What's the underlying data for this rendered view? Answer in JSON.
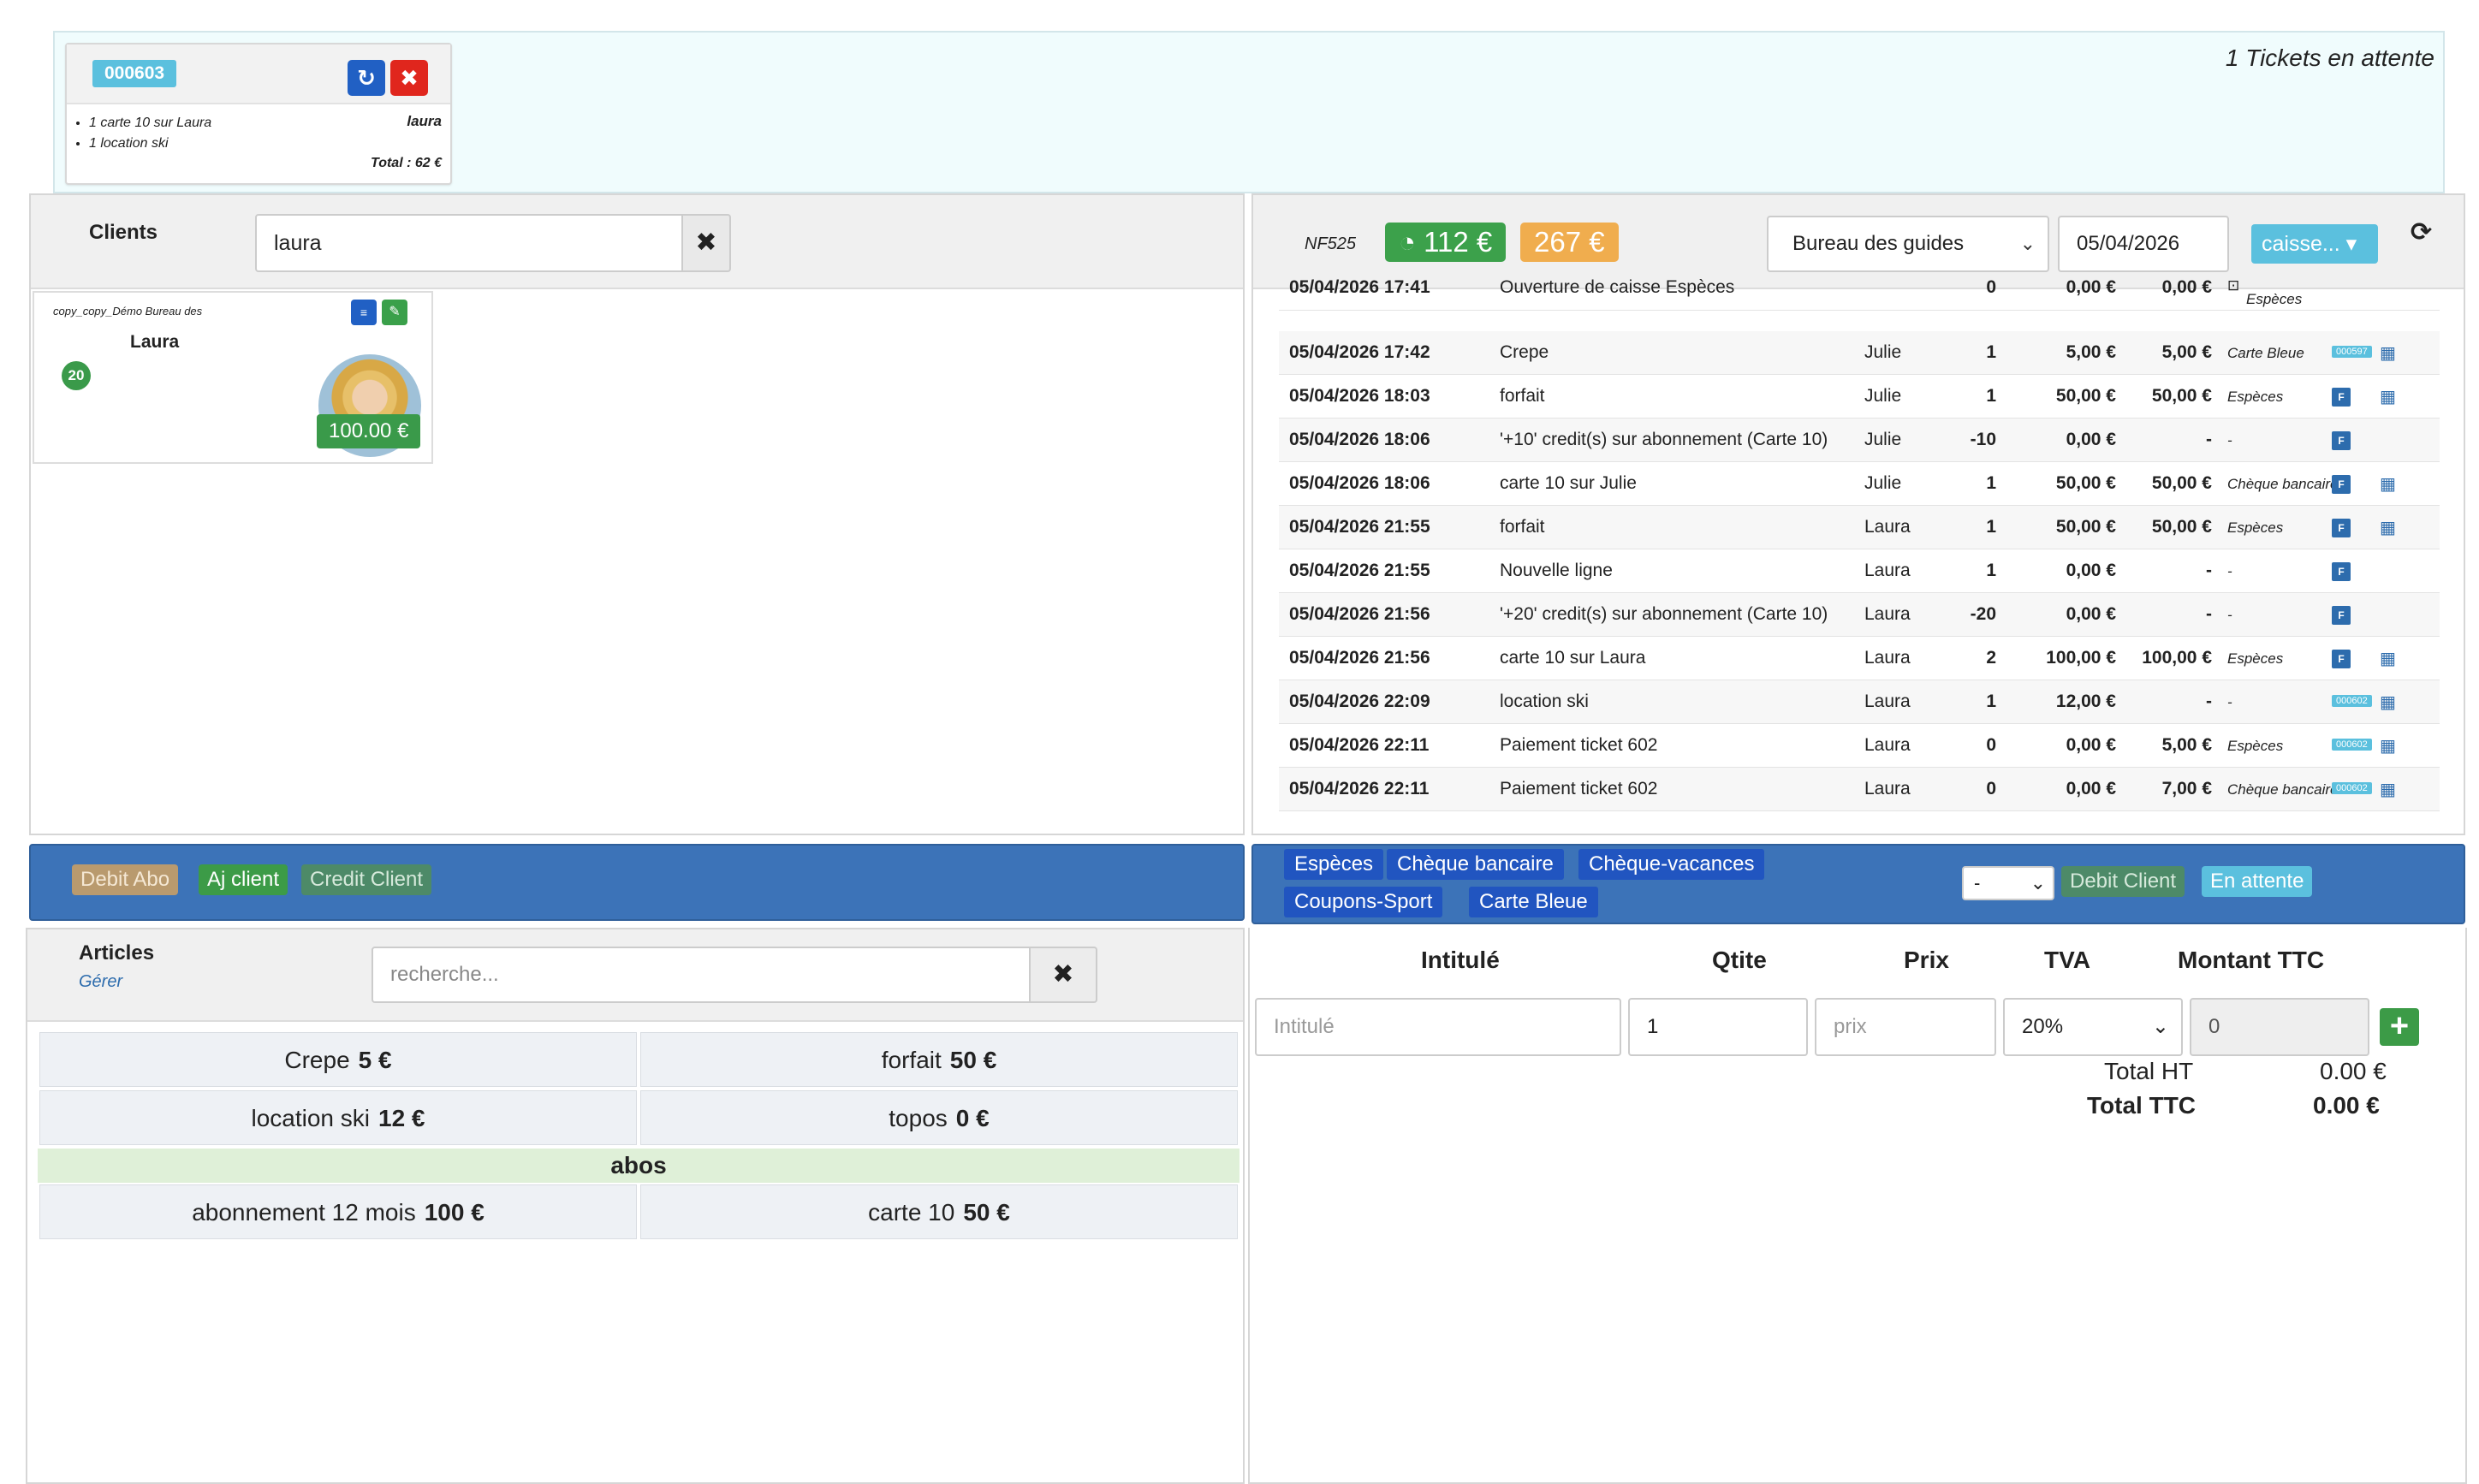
{
  "waiting": {
    "title": "1 Tickets en attente",
    "ticket": {
      "number": "000603",
      "lines": [
        "1 carte 10 sur Laura",
        "1 location ski"
      ],
      "client": "laura",
      "total": "Total : 62 €"
    }
  },
  "clients": {
    "title": "Clients",
    "search_value": "laura",
    "card": {
      "group": "copy_copy_Démo Bureau des",
      "name": "Laura",
      "credits": "20",
      "balance": "100.00 €"
    }
  },
  "sales": {
    "nf_label": "NF525",
    "badge_green": "112 €",
    "badge_orange": "267 €",
    "office": "Bureau des guides",
    "date": "05/04/2026",
    "caisse": "caisse...",
    "rows": [
      {
        "date": "05/04/2026 17:41",
        "label": "Ouverture de caisse Espèces",
        "user": "",
        "qty": "0",
        "price": "0,00 €",
        "paid": "0,00 €",
        "payment": "Espèces",
        "ticket": "",
        "invoice": false
      },
      {
        "date": "05/04/2026 17:42",
        "label": "Crepe",
        "user": "Julie",
        "qty": "1",
        "price": "5,00 €",
        "paid": "5,00 €",
        "payment": "Carte Bleue",
        "ticket": "000597",
        "invoice": false
      },
      {
        "date": "05/04/2026 18:03",
        "label": "forfait",
        "user": "Julie",
        "qty": "1",
        "price": "50,00 €",
        "paid": "50,00 €",
        "payment": "Espèces",
        "ticket": "",
        "invoice": true
      },
      {
        "date": "05/04/2026 18:06",
        "label": "'+10' credit(s) sur abonnement (Carte 10)",
        "user": "Julie",
        "qty": "-10",
        "price": "0,00 €",
        "paid": "-",
        "payment": "-",
        "ticket": "",
        "invoice": true
      },
      {
        "date": "05/04/2026 18:06",
        "label": "carte 10 sur Julie",
        "user": "Julie",
        "qty": "1",
        "price": "50,00 €",
        "paid": "50,00 €",
        "payment": "Chèque bancaire",
        "ticket": "",
        "invoice": true
      },
      {
        "date": "05/04/2026 21:55",
        "label": "forfait",
        "user": "Laura",
        "qty": "1",
        "price": "50,00 €",
        "paid": "50,00 €",
        "payment": "Espèces",
        "ticket": "",
        "invoice": true
      },
      {
        "date": "05/04/2026 21:55",
        "label": "Nouvelle ligne",
        "user": "Laura",
        "qty": "1",
        "price": "0,00 €",
        "paid": "-",
        "payment": "-",
        "ticket": "",
        "invoice": true
      },
      {
        "date": "05/04/2026 21:56",
        "label": "'+20' credit(s) sur abonnement (Carte 10)",
        "user": "Laura",
        "qty": "-20",
        "price": "0,00 €",
        "paid": "-",
        "payment": "-",
        "ticket": "",
        "invoice": true
      },
      {
        "date": "05/04/2026 21:56",
        "label": "carte 10 sur Laura",
        "user": "Laura",
        "qty": "2",
        "price": "100,00 €",
        "paid": "100,00 €",
        "payment": "Espèces",
        "ticket": "",
        "invoice": true
      },
      {
        "date": "05/04/2026 22:09",
        "label": "location ski",
        "user": "Laura",
        "qty": "1",
        "price": "12,00 €",
        "paid": "-",
        "payment": "-",
        "ticket": "000602",
        "invoice": false
      },
      {
        "date": "05/04/2026 22:11",
        "label": "Paiement ticket 602",
        "user": "Laura",
        "qty": "0",
        "price": "0,00 €",
        "paid": "5,00 €",
        "payment": "Espèces",
        "ticket": "000602",
        "invoice": false
      },
      {
        "date": "05/04/2026 22:11",
        "label": "Paiement ticket 602",
        "user": "Laura",
        "qty": "0",
        "price": "0,00 €",
        "paid": "7,00 €",
        "payment": "Chèque bancaire",
        "ticket": "000602",
        "invoice": false
      }
    ],
    "invoice_label": "F"
  },
  "left_actions": {
    "debit_abo": "Debit Abo",
    "aj_client": "Aj client",
    "credit_client": "Credit Client"
  },
  "right_actions": {
    "payments": [
      "Espèces",
      "Chèque bancaire",
      "Chèque-vacances",
      "Coupons-Sport",
      "Carte Bleue"
    ],
    "mode_value": "-",
    "debit_client": "Debit Client",
    "en_attente": "En attente"
  },
  "articles": {
    "title": "Articles",
    "manage": "Gérer",
    "search_placeholder": "recherche...",
    "items": [
      {
        "name": "Crepe",
        "price": "5 €"
      },
      {
        "name": "forfait",
        "price": "50 €"
      },
      {
        "name": "location ski",
        "price": "12 €"
      },
      {
        "name": "topos",
        "price": "0 €"
      }
    ],
    "category": "abos",
    "category_items": [
      {
        "name": "abonnement 12 mois",
        "price": "100 €"
      },
      {
        "name": "carte 10",
        "price": "50 €"
      }
    ]
  },
  "manual": {
    "headers": {
      "label": "Intitulé",
      "qty": "Qtite",
      "price": "Prix",
      "vat": "TVA",
      "ttc": "Montant TTC"
    },
    "label_placeholder": "Intitulé",
    "qty_value": "1",
    "price_placeholder": "prix",
    "vat_value": "20%",
    "ttc_value": "0",
    "total_ht_label": "Total HT",
    "total_ht_value": "0.00 €",
    "total_ttc_label": "Total TTC",
    "total_ttc_value": "0.00 €"
  }
}
